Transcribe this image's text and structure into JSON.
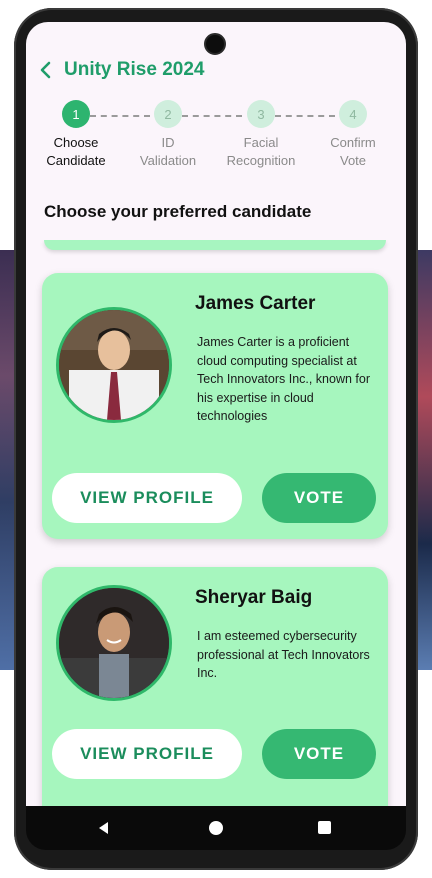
{
  "header": {
    "title": "Unity Rise 2024"
  },
  "stepper": {
    "steps": [
      {
        "number": "1",
        "label_line1": "Choose",
        "label_line2": "Candidate",
        "active": true
      },
      {
        "number": "2",
        "label_line1": "ID",
        "label_line2": "Validation",
        "active": false
      },
      {
        "number": "3",
        "label_line1": "Facial",
        "label_line2": "Recognition",
        "active": false
      },
      {
        "number": "4",
        "label_line1": "Confirm",
        "label_line2": "Vote",
        "active": false
      }
    ]
  },
  "section": {
    "title": "Choose your preferred candidate"
  },
  "candidates": [
    {
      "name": "James Carter",
      "description": "James Carter is a proficient cloud computing specialist at Tech Innovators Inc., known for his expertise in cloud technologies",
      "profile_label": "VIEW PROFILE",
      "vote_label": "VOTE"
    },
    {
      "name": "Sheryar Baig",
      "description": "I am esteemed cybersecurity professional at Tech Innovators Inc.",
      "profile_label": "VIEW PROFILE",
      "vote_label": "VOTE"
    }
  ],
  "colors": {
    "accent": "#1f9d6a",
    "card": "#a6f6be",
    "vote_button": "#35b872",
    "step_active": "#2db46f",
    "step_inactive": "#cfeedd"
  },
  "icons": {
    "back": "chevron-left-icon",
    "nav_back": "triangle-back-icon",
    "nav_home": "circle-home-icon",
    "nav_recents": "square-recents-icon"
  }
}
